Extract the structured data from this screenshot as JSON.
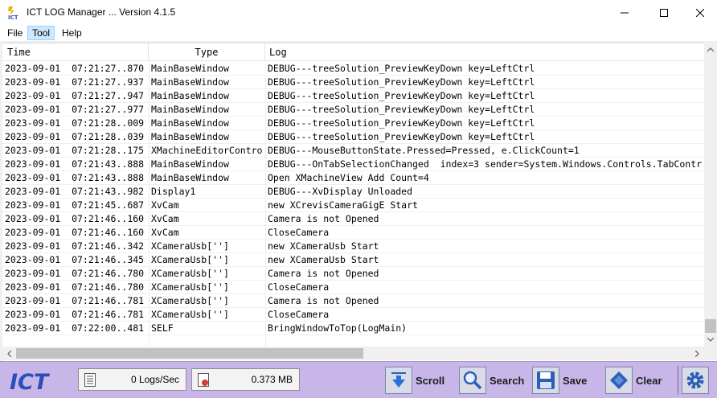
{
  "window": {
    "title": "ICT LOG Manager ... Version 4.1.5",
    "app_icon": "ict-app-icon"
  },
  "menu": {
    "file": "File",
    "tool": "Tool",
    "help": "Help"
  },
  "grid": {
    "columns": [
      "Time",
      "Type",
      "Log"
    ],
    "rows": [
      {
        "time": "2023-09-01  07:21:27..870",
        "type": "MainBaseWindow",
        "log": "DEBUG---treeSolution_PreviewKeyDown key=LeftCtrl"
      },
      {
        "time": "2023-09-01  07:21:27..937",
        "type": "MainBaseWindow",
        "log": "DEBUG---treeSolution_PreviewKeyDown key=LeftCtrl"
      },
      {
        "time": "2023-09-01  07:21:27..947",
        "type": "MainBaseWindow",
        "log": "DEBUG---treeSolution_PreviewKeyDown key=LeftCtrl"
      },
      {
        "time": "2023-09-01  07:21:27..977",
        "type": "MainBaseWindow",
        "log": "DEBUG---treeSolution_PreviewKeyDown key=LeftCtrl"
      },
      {
        "time": "2023-09-01  07:21:28..009",
        "type": "MainBaseWindow",
        "log": "DEBUG---treeSolution_PreviewKeyDown key=LeftCtrl"
      },
      {
        "time": "2023-09-01  07:21:28..039",
        "type": "MainBaseWindow",
        "log": "DEBUG---treeSolution_PreviewKeyDown key=LeftCtrl"
      },
      {
        "time": "2023-09-01  07:21:28..175",
        "type": "XMachineEditorContro",
        "log": "DEBUG---MouseButtonState.Pressed=Pressed, e.ClickCount=1"
      },
      {
        "time": "2023-09-01  07:21:43..888",
        "type": "MainBaseWindow",
        "log": "DEBUG---OnTabSelectionChanged  index=3 sender=System.Windows.Controls.TabContr"
      },
      {
        "time": "2023-09-01  07:21:43..888",
        "type": "MainBaseWindow",
        "log": "Open XMachineView Add Count=4"
      },
      {
        "time": "2023-09-01  07:21:43..982",
        "type": "Display1",
        "log": "DEBUG---XvDisplay Unloaded"
      },
      {
        "time": "2023-09-01  07:21:45..687",
        "type": "XvCam",
        "log": "new XCrevisCameraGigE Start"
      },
      {
        "time": "2023-09-01  07:21:46..160",
        "type": "XvCam",
        "log": "Camera is not Opened"
      },
      {
        "time": "2023-09-01  07:21:46..160",
        "type": "XvCam",
        "log": "CloseCamera"
      },
      {
        "time": "2023-09-01  07:21:46..342",
        "type": "XCameraUsb['']",
        "log": "new XCameraUsb Start"
      },
      {
        "time": "2023-09-01  07:21:46..345",
        "type": "XCameraUsb['']",
        "log": "new XCameraUsb Start"
      },
      {
        "time": "2023-09-01  07:21:46..780",
        "type": "XCameraUsb['']",
        "log": "Camera is not Opened"
      },
      {
        "time": "2023-09-01  07:21:46..780",
        "type": "XCameraUsb['']",
        "log": "CloseCamera"
      },
      {
        "time": "2023-09-01  07:21:46..781",
        "type": "XCameraUsb['']",
        "log": "Camera is not Opened"
      },
      {
        "time": "2023-09-01  07:21:46..781",
        "type": "XCameraUsb['']",
        "log": "CloseCamera"
      },
      {
        "time": "2023-09-01  07:22:00..481",
        "type": "SELF",
        "log": "BringWindowToTop(LogMain)"
      }
    ]
  },
  "toolbar": {
    "brand": "ICT",
    "logs_rate": "0 Logs/Sec",
    "memory": "0.373 MB",
    "scroll_label": "Scroll",
    "search_label": "Search",
    "save_label": "Save",
    "clear_label": "Clear",
    "accent": "#c8b6e8",
    "brand_color": "#2b4fb8"
  }
}
